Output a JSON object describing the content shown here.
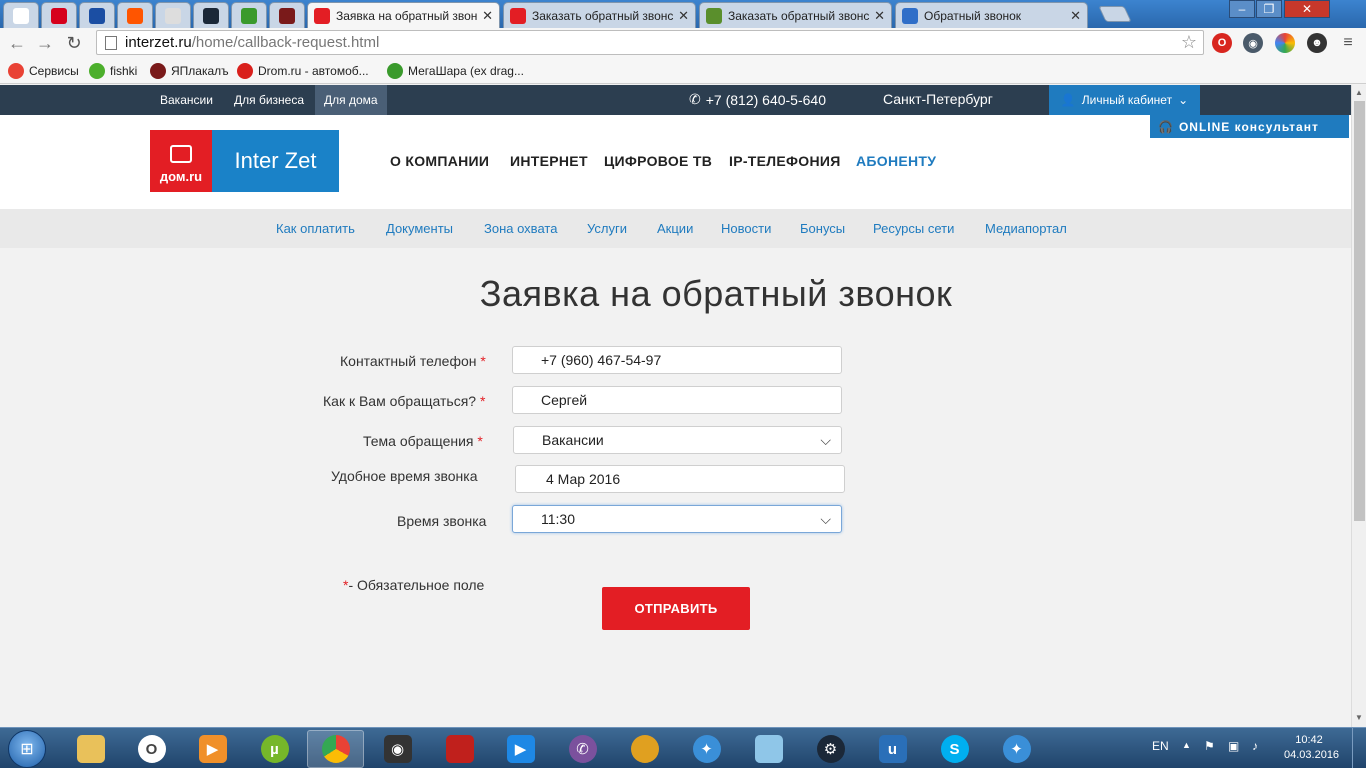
{
  "browser": {
    "tabs": [
      {
        "label": "",
        "icon": "analytics-icon",
        "color": "#ffffff",
        "pinned": true
      },
      {
        "label": "",
        "icon": "hh-icon",
        "color": "#d6001c",
        "pinned": true
      },
      {
        "label": "",
        "icon": "sports-icon",
        "color": "#1b4ea3",
        "pinned": true
      },
      {
        "label": "",
        "icon": "soundcloud-icon",
        "color": "#ff5500",
        "pinned": true
      },
      {
        "label": "",
        "icon": "blank-icon",
        "color": "#dddddd",
        "pinned": true
      },
      {
        "label": "",
        "icon": "steam-icon",
        "color": "#1b2838",
        "pinned": true
      },
      {
        "label": "",
        "icon": "megashara-icon",
        "color": "#3a9a2c",
        "pinned": true
      },
      {
        "label": "",
        "icon": "yaplakal-icon",
        "color": "#7a1a1a",
        "pinned": true
      },
      {
        "label": "Заявка на обратный звон",
        "icon": "interzet-icon",
        "color": "#e31e24",
        "active": true
      },
      {
        "label": "Заказать обратный звонс",
        "icon": "mvideo-icon",
        "color": "#e31e24"
      },
      {
        "label": "Заказать обратный звонс",
        "icon": "leaf-icon",
        "color": "#5a8f2c"
      },
      {
        "label": "Обратный звонок",
        "icon": "blue-icon",
        "color": "#2f6ec8"
      }
    ],
    "url_host": "interzet.ru",
    "url_path": "/home/callback-request.html",
    "bookmarks": [
      {
        "label": "Сервисы",
        "icon": "apps-icon",
        "color": "#e94235"
      },
      {
        "label": "fishki",
        "icon": "fishki-icon",
        "color": "#4caf2c"
      },
      {
        "label": "ЯПлакалъ",
        "icon": "yaplakal-icon",
        "color": "#7a1a1a"
      },
      {
        "label": "Drom.ru - автомоб...",
        "icon": "drom-icon",
        "color": "#d9201c"
      },
      {
        "label": "МегаШара (ex drag...",
        "icon": "megashara-icon",
        "color": "#3a9a2c"
      }
    ]
  },
  "site": {
    "topbar": {
      "segments": [
        "Вакансии",
        "Для бизнеса",
        "Для дома"
      ],
      "active_segment": "Для дома",
      "phone": "+7 (812) 640-5-640",
      "city": "Санкт-Петербург",
      "cabinet": "Личный кабинет",
      "online": "ONLINE  консультант"
    },
    "logo": {
      "left": "дом.ru",
      "right": "Inter Zet"
    },
    "main_nav": [
      "О КОМПАНИИ",
      "ИНТЕРНЕТ",
      "ЦИФРОВОЕ ТВ",
      "IP-ТЕЛЕФОНИЯ",
      "АБОНЕНТУ"
    ],
    "main_nav_active": "АБОНЕНТУ",
    "sub_nav": [
      "Как оплатить",
      "Документы",
      "Зона охвата",
      "Услуги",
      "Акции",
      "Новости",
      "Бонусы",
      "Ресурсы сети",
      "Медиапортал"
    ],
    "title": "Заявка на обратный звонок",
    "form": {
      "phone_label": "Контактный телефон",
      "phone_value": "+7 (960) 467-54-97",
      "name_label": "Как к Вам обращаться?",
      "name_value": "Сергей",
      "topic_label": "Тема обращения",
      "topic_value": "Вакансии",
      "date_label": "Удобное время звонка",
      "date_value": "4 Мар 2016",
      "time_label": "Время звонка",
      "time_value": "11:30",
      "required_mark": "*",
      "required_note": "- Обязательное поле",
      "submit": "ОТПРАВИТЬ"
    },
    "colors": {
      "brand_red": "#e31e24",
      "brand_blue": "#1f7bbf",
      "topbar": "#2c3e50"
    }
  },
  "taskbar": {
    "lang": "EN",
    "time": "10:42",
    "date": "04.03.2016"
  }
}
